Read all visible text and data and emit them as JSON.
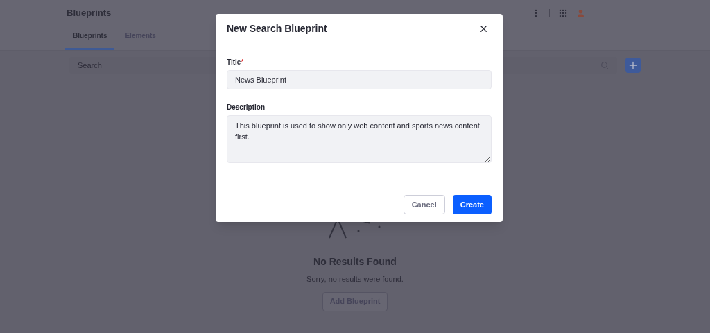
{
  "header": {
    "title": "Blueprints"
  },
  "tabs": [
    {
      "label": "Blueprints",
      "selected": true
    },
    {
      "label": "Elements",
      "selected": false
    }
  ],
  "search": {
    "placeholder": "Search"
  },
  "empty_state": {
    "title": "No Results Found",
    "message": "Sorry, no results were found.",
    "button": "Add Blueprint"
  },
  "modal": {
    "title": "New Search Blueprint",
    "fields": [
      {
        "kind": "input",
        "label": "Title",
        "required_mark": "*",
        "value": "News Blueprint"
      },
      {
        "kind": "textarea",
        "label": "Description",
        "value": "This blueprint is used to show only web content and sports news content first."
      }
    ],
    "buttons": [
      {
        "label": "Cancel",
        "kind": "secondary"
      },
      {
        "label": "Create",
        "kind": "primary"
      }
    ]
  }
}
